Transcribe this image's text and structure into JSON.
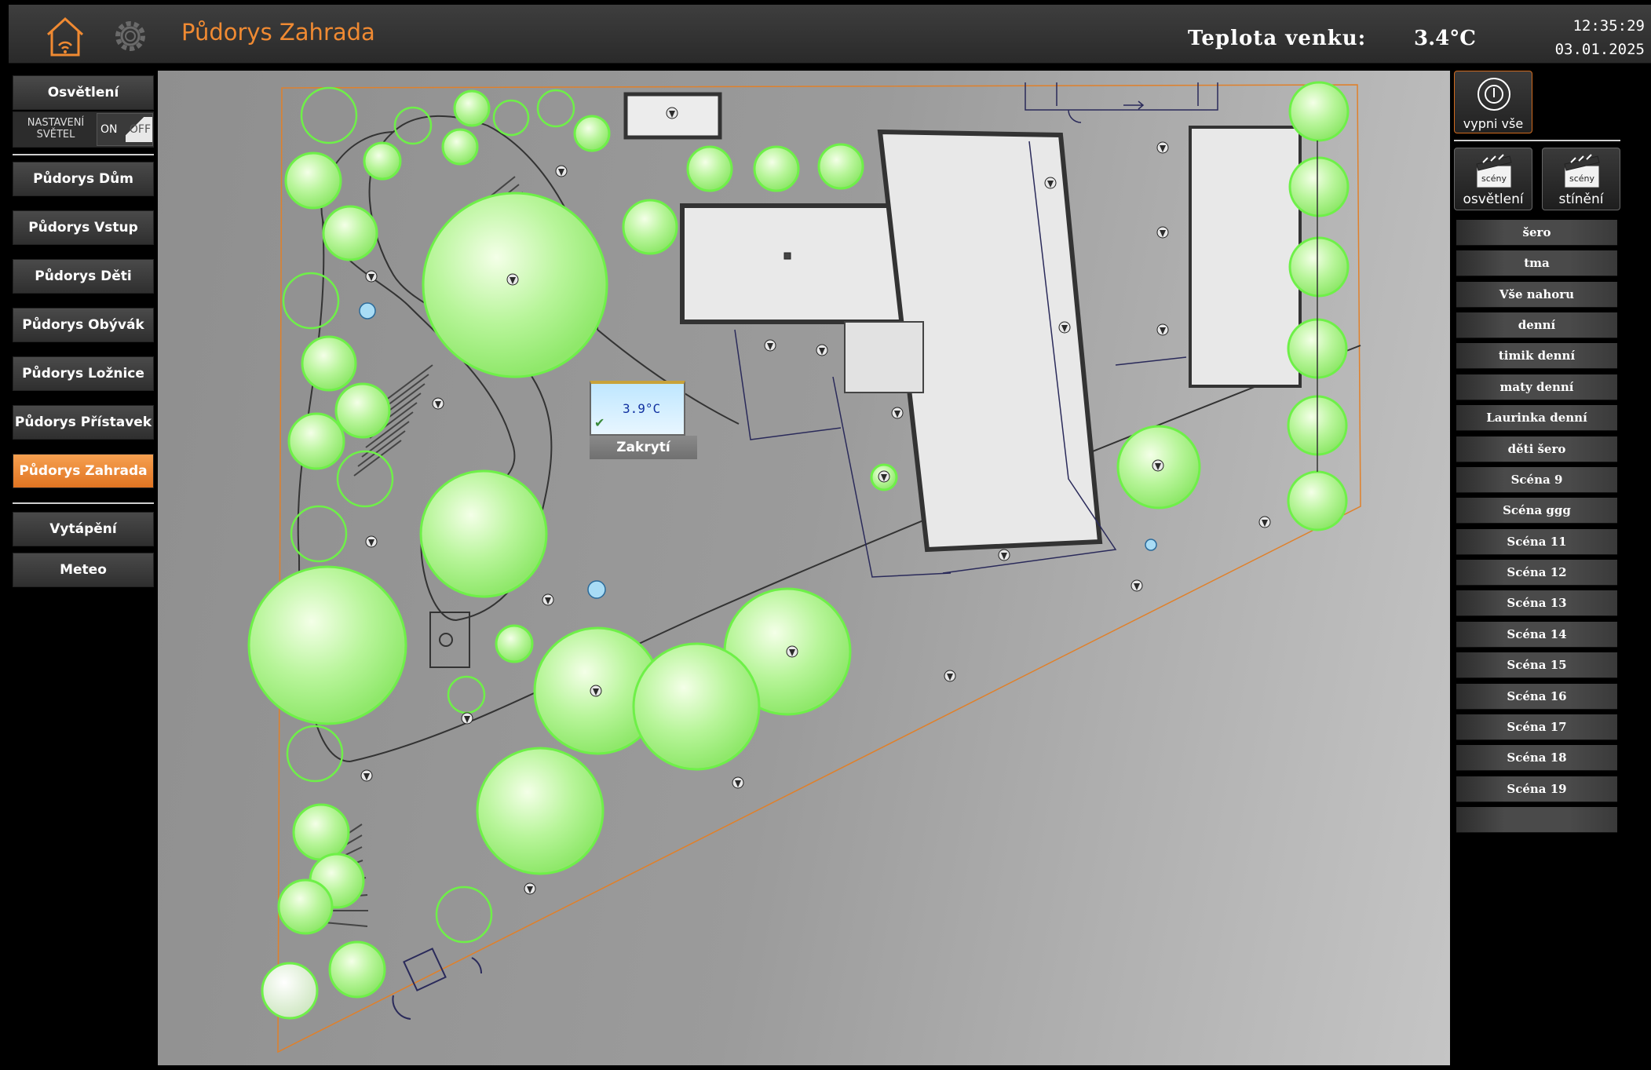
{
  "header": {
    "title": "Půdorys Zahrada",
    "temp_label": "Teplota venku:",
    "temp_value": "3.4°C",
    "time": "12:35:29",
    "date": "03.01.2025",
    "home_icon": "home-wifi-icon",
    "settings_icon": "gear-icon"
  },
  "nav": {
    "items": [
      {
        "label": "Osvětlení"
      },
      {
        "label": "Půdorys Dům"
      },
      {
        "label": "Půdorys Vstup"
      },
      {
        "label": "Půdorys Děti"
      },
      {
        "label": "Půdorys Obývák"
      },
      {
        "label": "Půdorys Ložnice"
      },
      {
        "label": "Půdorys Přístavek"
      },
      {
        "label": "Půdorys Zahrada",
        "active": true
      },
      {
        "label": "Vytápění"
      },
      {
        "label": "Meteo"
      }
    ],
    "lights_settings": {
      "label_line1": "NASTAVENÍ",
      "label_line2": "SVĚTEL",
      "on": "ON",
      "off": "OFF"
    }
  },
  "plan": {
    "thermostat_value": "3.9°C",
    "cover_label": "Zakrytí",
    "lamp_icon": "garden-light-icon"
  },
  "right": {
    "all_off": "vypni vše",
    "scenes_lights_top": "scény",
    "scenes_lights": "osvětlení",
    "scenes_shading_top": "scény",
    "scenes_shading": "stínění",
    "scenes": [
      "šero",
      "tma",
      "Vše nahoru",
      "denní",
      "timik denní",
      "maty denní",
      "Laurinka denní",
      "děti šero",
      "Scéna 9",
      "Scéna ggg",
      "Scéna 11",
      "Scéna 12",
      "Scéna 13",
      "Scéna 14",
      "Scéna 15",
      "Scéna 16",
      "Scéna 17",
      "Scéna 18",
      "Scéna 19",
      ""
    ]
  },
  "colors": {
    "accent": "#f08a32",
    "tree": "#9ef27a",
    "background": "#000000"
  }
}
